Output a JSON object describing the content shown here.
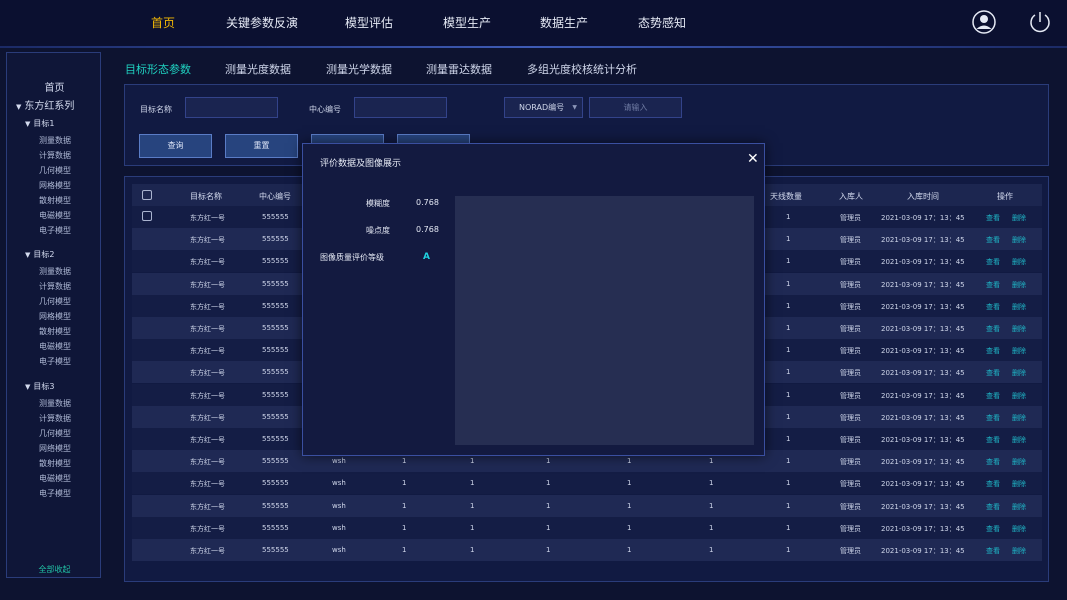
{
  "topnav": {
    "items": [
      "首页",
      "关键参数反演",
      "模型评估",
      "模型生产",
      "数据生产",
      "态势感知"
    ],
    "active_color": "#f2b705",
    "icons": [
      "user-avatar-icon",
      "power-icon"
    ]
  },
  "sidebar": {
    "home": "首页",
    "system": "东方红系列",
    "groups": [
      {
        "label": "目标1",
        "items": [
          "测量数据",
          "计算数据",
          "几何模型",
          "网格模型",
          "散射模型",
          "电磁模型",
          "电子模型"
        ]
      },
      {
        "label": "目标2",
        "items": [
          "测量数据",
          "计算数据",
          "几何模型",
          "网格模型",
          "散射模型",
          "电磁模型",
          "电子模型"
        ]
      },
      {
        "label": "目标3",
        "items": [
          "测量数据",
          "计算数据",
          "几何模型",
          "网络模型",
          "散射模型",
          "电磁模型",
          "电子模型"
        ]
      }
    ],
    "collapse_all": "全部收起"
  },
  "subtabs": [
    "目标形态参数",
    "测量光度数据",
    "测量光学数据",
    "测量雷达数据",
    "多组光度校核统计分析"
  ],
  "filter": {
    "name_label": "目标名称",
    "center_label": "中心编号",
    "norad_select": "NORAD编号",
    "norad_placeholder": "请输入",
    "query_button": "查询",
    "reset_button": "重置"
  },
  "table": {
    "headers": [
      "目标名称",
      "中心编号",
      "天线数量",
      "入库人",
      "入库时间",
      "操作"
    ],
    "rows": [
      {
        "name": "东方红一号",
        "center": "555555",
        "col3": "",
        "c4": "",
        "c5": "",
        "c6": "",
        "c7": "",
        "c8": "",
        "antenna": "1",
        "user": "管理员",
        "time": "2021-03-09 17：13：45",
        "view": "查看",
        "del": "删除"
      },
      {
        "name": "东方红一号",
        "center": "555555",
        "col3": "",
        "c4": "",
        "c5": "",
        "c6": "",
        "c7": "",
        "c8": "",
        "antenna": "1",
        "user": "管理员",
        "time": "2021-03-09 17：13：45",
        "view": "查看",
        "del": "删除"
      },
      {
        "name": "东方红一号",
        "center": "555555",
        "col3": "",
        "c4": "",
        "c5": "",
        "c6": "",
        "c7": "",
        "c8": "",
        "antenna": "1",
        "user": "管理员",
        "time": "2021-03-09 17：13：45",
        "view": "查看",
        "del": "删除"
      },
      {
        "name": "东方红一号",
        "center": "555555",
        "col3": "",
        "c4": "",
        "c5": "",
        "c6": "",
        "c7": "",
        "c8": "",
        "antenna": "1",
        "user": "管理员",
        "time": "2021-03-09 17：13：45",
        "view": "查看",
        "del": "删除"
      },
      {
        "name": "东方红一号",
        "center": "555555",
        "col3": "",
        "c4": "",
        "c5": "",
        "c6": "",
        "c7": "",
        "c8": "",
        "antenna": "1",
        "user": "管理员",
        "time": "2021-03-09 17：13：45",
        "view": "查看",
        "del": "删除"
      },
      {
        "name": "东方红一号",
        "center": "555555",
        "col3": "",
        "c4": "",
        "c5": "",
        "c6": "",
        "c7": "",
        "c8": "",
        "antenna": "1",
        "user": "管理员",
        "time": "2021-03-09 17：13：45",
        "view": "查看",
        "del": "删除"
      },
      {
        "name": "东方红一号",
        "center": "555555",
        "col3": "",
        "c4": "",
        "c5": "",
        "c6": "",
        "c7": "",
        "c8": "",
        "antenna": "1",
        "user": "管理员",
        "time": "2021-03-09 17：13：45",
        "view": "查看",
        "del": "删除"
      },
      {
        "name": "东方红一号",
        "center": "555555",
        "col3": "",
        "c4": "",
        "c5": "",
        "c6": "",
        "c7": "",
        "c8": "",
        "antenna": "1",
        "user": "管理员",
        "time": "2021-03-09 17：13：45",
        "view": "查看",
        "del": "删除"
      },
      {
        "name": "东方红一号",
        "center": "555555",
        "col3": "",
        "c4": "",
        "c5": "",
        "c6": "",
        "c7": "",
        "c8": "",
        "antenna": "1",
        "user": "管理员",
        "time": "2021-03-09 17：13：45",
        "view": "查看",
        "del": "删除"
      },
      {
        "name": "东方红一号",
        "center": "555555",
        "col3": "",
        "c4": "",
        "c5": "",
        "c6": "",
        "c7": "",
        "c8": "",
        "antenna": "1",
        "user": "管理员",
        "time": "2021-03-09 17：13：45",
        "view": "查看",
        "del": "删除"
      },
      {
        "name": "东方红一号",
        "center": "555555",
        "col3": "",
        "c4": "",
        "c5": "",
        "c6": "",
        "c7": "",
        "c8": "",
        "antenna": "1",
        "user": "管理员",
        "time": "2021-03-09 17：13：45",
        "view": "查看",
        "del": "删除"
      },
      {
        "name": "东方红一号",
        "center": "555555",
        "col3": "wsh",
        "c4": "1",
        "c5": "1",
        "c6": "1",
        "c7": "1",
        "c8": "1",
        "antenna": "1",
        "user": "管理员",
        "time": "2021-03-09 17：13：45",
        "view": "查看",
        "del": "删除"
      },
      {
        "name": "东方红一号",
        "center": "555555",
        "col3": "wsh",
        "c4": "1",
        "c5": "1",
        "c6": "1",
        "c7": "1",
        "c8": "1",
        "antenna": "1",
        "user": "管理员",
        "time": "2021-03-09 17：13：45",
        "view": "查看",
        "del": "删除"
      },
      {
        "name": "东方红一号",
        "center": "555555",
        "col3": "wsh",
        "c4": "1",
        "c5": "1",
        "c6": "1",
        "c7": "1",
        "c8": "1",
        "antenna": "1",
        "user": "管理员",
        "time": "2021-03-09 17：13：45",
        "view": "查看",
        "del": "删除"
      },
      {
        "name": "东方红一号",
        "center": "555555",
        "col3": "wsh",
        "c4": "1",
        "c5": "1",
        "c6": "1",
        "c7": "1",
        "c8": "1",
        "antenna": "1",
        "user": "管理员",
        "time": "2021-03-09 17：13：45",
        "view": "查看",
        "del": "删除"
      },
      {
        "name": "东方红一号",
        "center": "555555",
        "col3": "wsh",
        "c4": "1",
        "c5": "1",
        "c6": "1",
        "c7": "1",
        "c8": "1",
        "antenna": "1",
        "user": "管理员",
        "time": "2021-03-09 17：13：45",
        "view": "查看",
        "del": "删除"
      }
    ]
  },
  "modal": {
    "title": "评价数据及图像展示",
    "close": "✕",
    "blur_label": "模糊度",
    "blur_value": "0.768",
    "noise_label": "噪点度",
    "noise_value": "0.768",
    "grade_label": "图像质量评价等级",
    "grade_value": "A",
    "grade_color": "#1fd1e0"
  }
}
